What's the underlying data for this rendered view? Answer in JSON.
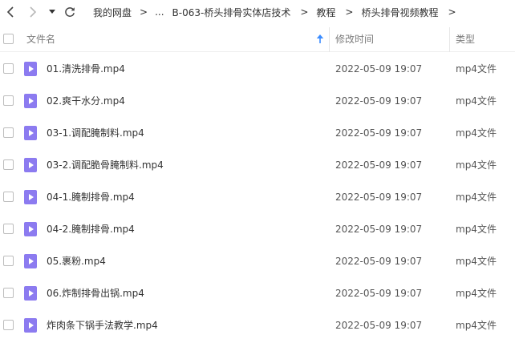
{
  "breadcrumb": {
    "root": "我的网盘",
    "separator": ">",
    "ellipsis": "...",
    "items": [
      "B-063-桥头排骨实体店技术",
      "教程",
      "桥头排骨视频教程"
    ]
  },
  "columns": {
    "name": "文件名",
    "modified": "修改时间",
    "type": "类型"
  },
  "files": [
    {
      "name": "01.清洗排骨.mp4",
      "modified": "2022-05-09 19:07",
      "type": "mp4文件"
    },
    {
      "name": "02.爽干水分.mp4",
      "modified": "2022-05-09 19:07",
      "type": "mp4文件"
    },
    {
      "name": "03-1.调配腌制料.mp4",
      "modified": "2022-05-09 19:07",
      "type": "mp4文件"
    },
    {
      "name": "03-2.调配脆骨腌制料.mp4",
      "modified": "2022-05-09 19:07",
      "type": "mp4文件"
    },
    {
      "name": "04-1.腌制排骨.mp4",
      "modified": "2022-05-09 19:07",
      "type": "mp4文件"
    },
    {
      "name": "04-2.腌制排骨.mp4",
      "modified": "2022-05-09 19:07",
      "type": "mp4文件"
    },
    {
      "name": "05.裹粉.mp4",
      "modified": "2022-05-09 19:07",
      "type": "mp4文件"
    },
    {
      "name": "06.炸制排骨出锅.mp4",
      "modified": "2022-05-09 19:07",
      "type": "mp4文件"
    },
    {
      "name": "炸肉条下锅手法教学.mp4",
      "modified": "2022-05-09 19:07",
      "type": "mp4文件"
    }
  ],
  "colors": {
    "accent": "#3b8cff",
    "video_icon": "#8c7bf0"
  }
}
